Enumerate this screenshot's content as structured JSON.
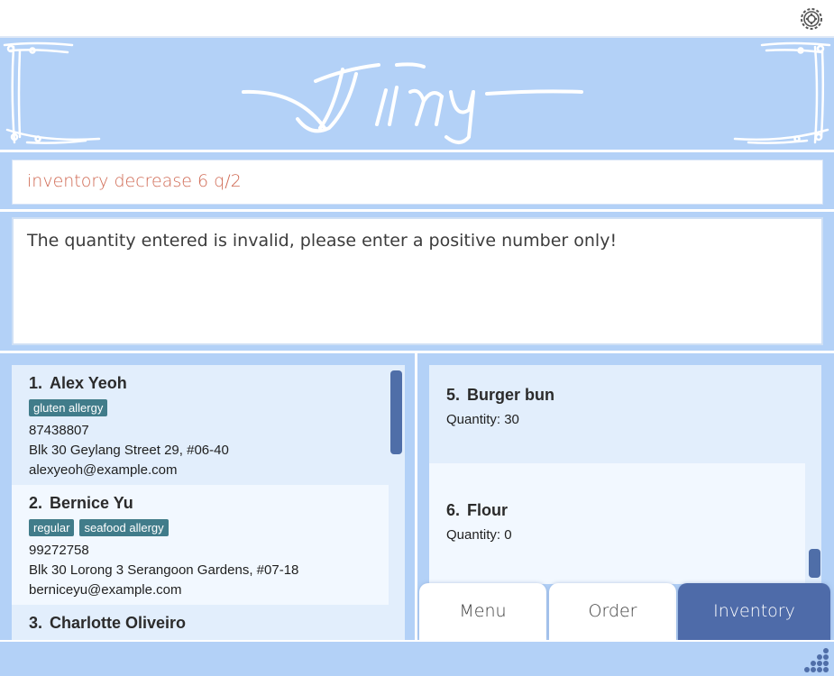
{
  "app": {
    "logo_text": "Jimy"
  },
  "command": {
    "value": "inventory decrease 6 q/2"
  },
  "result": {
    "message": "The quantity entered is invalid, please enter a positive number only!"
  },
  "persons": [
    {
      "index": "1.",
      "name": "Alex Yeoh",
      "tags": [
        "gluten allergy"
      ],
      "phone": "87438807",
      "address": "Blk 30 Geylang Street 29, #06-40",
      "email": "alexyeoh@example.com"
    },
    {
      "index": "2.",
      "name": "Bernice Yu",
      "tags": [
        "regular",
        "seafood allergy"
      ],
      "phone": "99272758",
      "address": "Blk 30 Lorong 3 Serangoon Gardens, #07-18",
      "email": "berniceyu@example.com"
    },
    {
      "index": "3.",
      "name": "Charlotte Oliveiro"
    }
  ],
  "inventory": [
    {
      "index": "5.",
      "name": "Burger bun",
      "quantity": "Quantity: 30"
    },
    {
      "index": "6.",
      "name": "Flour",
      "quantity": "Quantity: 0"
    }
  ],
  "tabs": {
    "menu": "Menu",
    "order": "Order",
    "inventory": "Inventory",
    "active": "inventory"
  },
  "icons": {
    "settings": "gear-icon",
    "resize": "resize-grip-icon"
  },
  "colors": {
    "accent": "#4e6ba9",
    "tag": "#417c8a",
    "command_text": "#d06a54",
    "background": "#b3d1f7"
  }
}
